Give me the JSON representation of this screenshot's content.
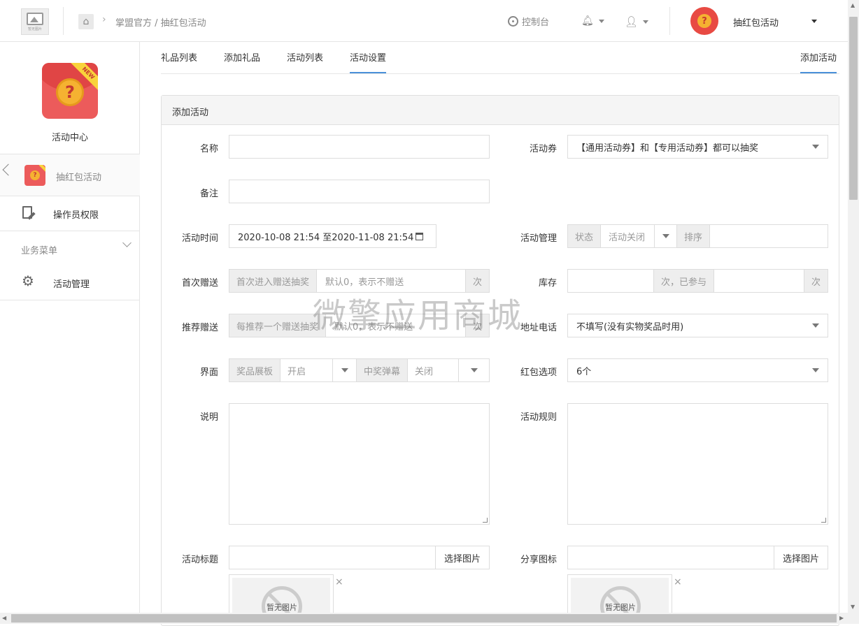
{
  "header": {
    "logo_caption": "暂无图片",
    "breadcrumb": "掌盟官方 / 抽红包活动",
    "console_label": "控制台",
    "account_name": "抽红包活动"
  },
  "sidebar": {
    "app_badge": "NEW",
    "app_title": "活动中心",
    "active_item": "抽红包活动",
    "items": [
      {
        "label": "操作员权限"
      },
      {
        "label": "业务菜单"
      },
      {
        "label": "活动管理"
      }
    ]
  },
  "tabs": [
    {
      "label": "礼品列表"
    },
    {
      "label": "添加礼品"
    },
    {
      "label": "活动列表"
    },
    {
      "label": "活动设置"
    },
    {
      "label": "添加活动"
    }
  ],
  "panel": {
    "title": "添加活动"
  },
  "form": {
    "name_label": "名称",
    "note_label": "备注",
    "voucher_label": "活动券",
    "voucher_value": "【通用活动券】和【专用活动券】都可以抽奖",
    "time_label": "活动时间",
    "time_value": "2020-10-08 21:54 至2020-11-08 21:54",
    "manage_label": "活动管理",
    "manage_status_addon": "状态",
    "manage_status_value": "活动关闭",
    "manage_sort_addon": "排序",
    "first_gift_label": "首次赠送",
    "first_gift_addon": "首次进入赠送抽奖",
    "first_gift_placeholder": "默认0，表示不赠送",
    "first_gift_unit": "次",
    "stock_label": "库存",
    "stock_mid_addon": "次，已参与",
    "stock_unit": "次",
    "recommend_label": "推荐赠送",
    "recommend_addon": "每推荐一个赠送抽奖",
    "recommend_placeholder": "默认0，表示不赠送",
    "recommend_unit": "次",
    "address_label": "地址电话",
    "address_value": "不填写(没有实物奖品时用)",
    "ui_label": "界面",
    "ui_addon1": "奖品展板",
    "ui_value1": "开启",
    "ui_addon2": "中奖弹幕",
    "ui_value2": "关闭",
    "redpack_label": "红包选项",
    "redpack_value": "6个",
    "desc_label": "说明",
    "rules_label": "活动规则",
    "title_label": "活动标题",
    "title_button": "选择图片",
    "share_label": "分享图标",
    "share_button": "选择图片",
    "no_image_text": "暂无图片",
    "remove_icon": "×"
  },
  "watermark": "微擎应用商城"
}
